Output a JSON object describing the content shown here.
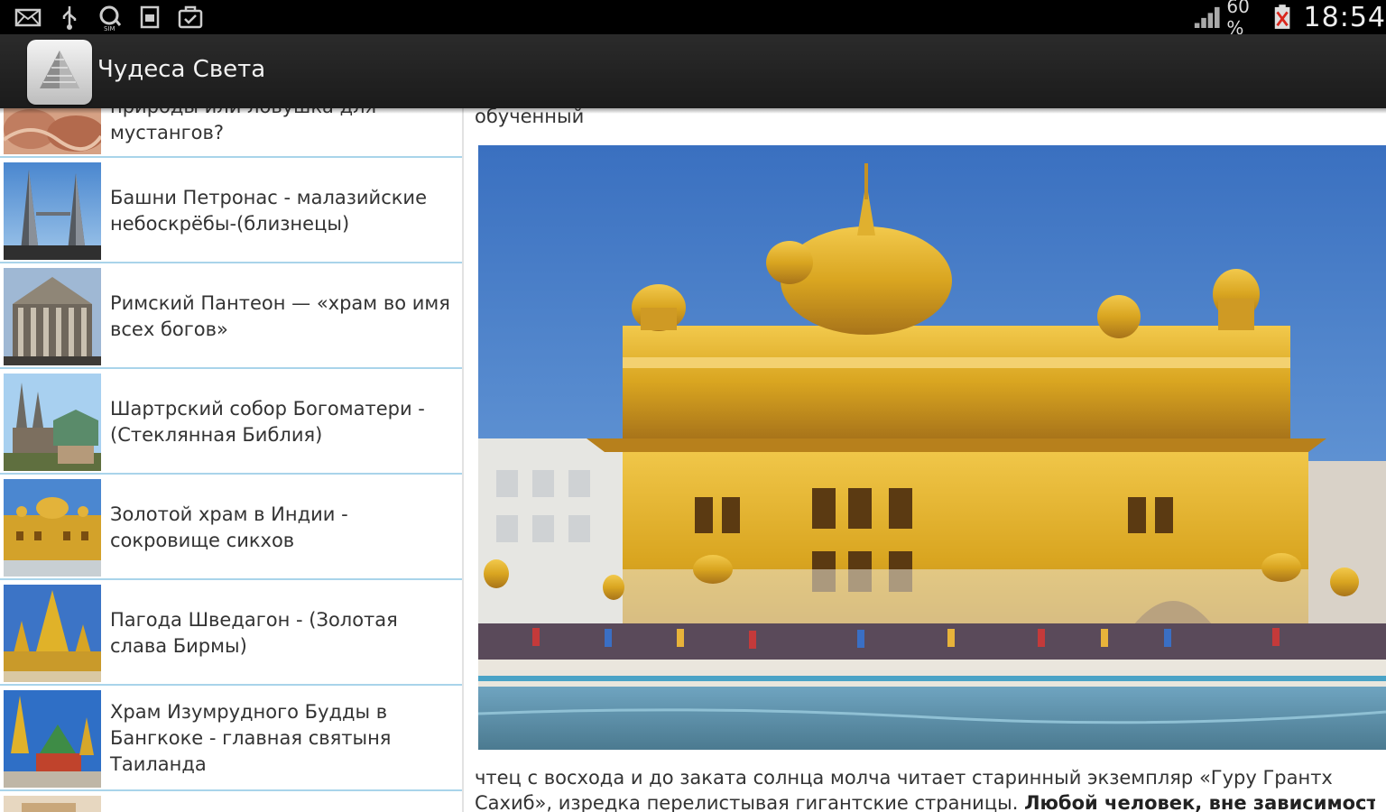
{
  "status_bar": {
    "battery_percent": "60 %",
    "time": "18:54",
    "left_icons": [
      "mail-icon",
      "usb-icon",
      "sync-icon",
      "sim-icon",
      "clipboard-icon"
    ],
    "right_icons": [
      "signal-icon",
      "battery-icon"
    ]
  },
  "action_bar": {
    "app_title": "Чудеса Света",
    "app_icon": "pyramid-icon"
  },
  "list": {
    "items": [
      {
        "label": "мустангов?",
        "label_partial_top": "природы или ловушка для",
        "thumb": "rocks"
      },
      {
        "label": "Башни Петронас - малазийские небоскрёбы-(близнецы)",
        "thumb": "petronas"
      },
      {
        "label": "Римский Пантеон — «храм во имя всех богов»",
        "thumb": "pantheon"
      },
      {
        "label": "Шартрский собор Богоматери - (Стеклянная Библия)",
        "thumb": "chartres"
      },
      {
        "label": "Золотой храм в Индии - сокровище сикхов",
        "thumb": "golden-temple"
      },
      {
        "label": "Пагода Шведагон - (Золотая слава Бирмы)",
        "thumb": "shwedagon"
      },
      {
        "label": "Храм Изумрудного Будды в Бангкоке - главная святыня Таиланда",
        "thumb": "emerald-buddha"
      }
    ]
  },
  "article": {
    "top_partial_text": "обученный",
    "line1": "чтец с восхода и до заката солнца молча читает старинный экземпляр «Гуру Грантх",
    "line2_plain": "Сахиб», изредка перелистывая гигантские страницы. ",
    "line2_bold": "Любой человек, вне зависимости"
  },
  "colors": {
    "status_bar_bg": "#000000",
    "action_bar_bg": "#222222",
    "list_divider": "#a9d4ea",
    "sky": "#3f79c4",
    "gold": "#d9a520"
  }
}
